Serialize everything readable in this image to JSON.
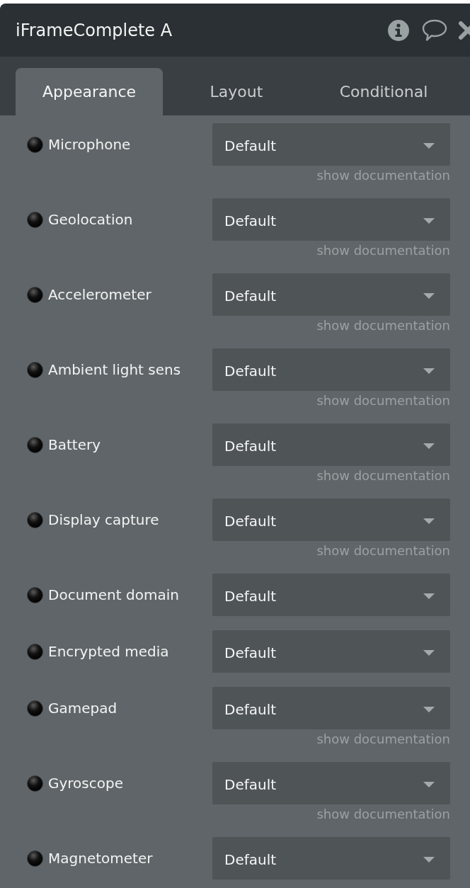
{
  "header": {
    "title": "iFrameComplete A"
  },
  "tabs": [
    {
      "label": "Appearance",
      "selected": true
    },
    {
      "label": "Layout",
      "selected": false
    },
    {
      "label": "Conditional",
      "selected": false
    }
  ],
  "properties": [
    {
      "label": "Microphone",
      "value": "Default",
      "documentation_link": "show documentation"
    },
    {
      "label": "Geolocation",
      "value": "Default",
      "documentation_link": "show documentation"
    },
    {
      "label": "Accelerometer",
      "value": "Default",
      "documentation_link": "show documentation"
    },
    {
      "label": "Ambient light sens",
      "value": "Default",
      "documentation_link": "show documentation"
    },
    {
      "label": "Battery",
      "value": "Default",
      "documentation_link": "show documentation"
    },
    {
      "label": "Display capture",
      "value": "Default",
      "documentation_link": "show documentation"
    },
    {
      "label": "Document domain",
      "value": "Default"
    },
    {
      "label": "Encrypted media",
      "value": "Default"
    },
    {
      "label": "Gamepad",
      "value": "Default",
      "documentation_link": "show documentation"
    },
    {
      "label": "Gyroscope",
      "value": "Default",
      "documentation_link": "show documentation"
    },
    {
      "label": "Magnetometer",
      "value": "Default"
    }
  ]
}
